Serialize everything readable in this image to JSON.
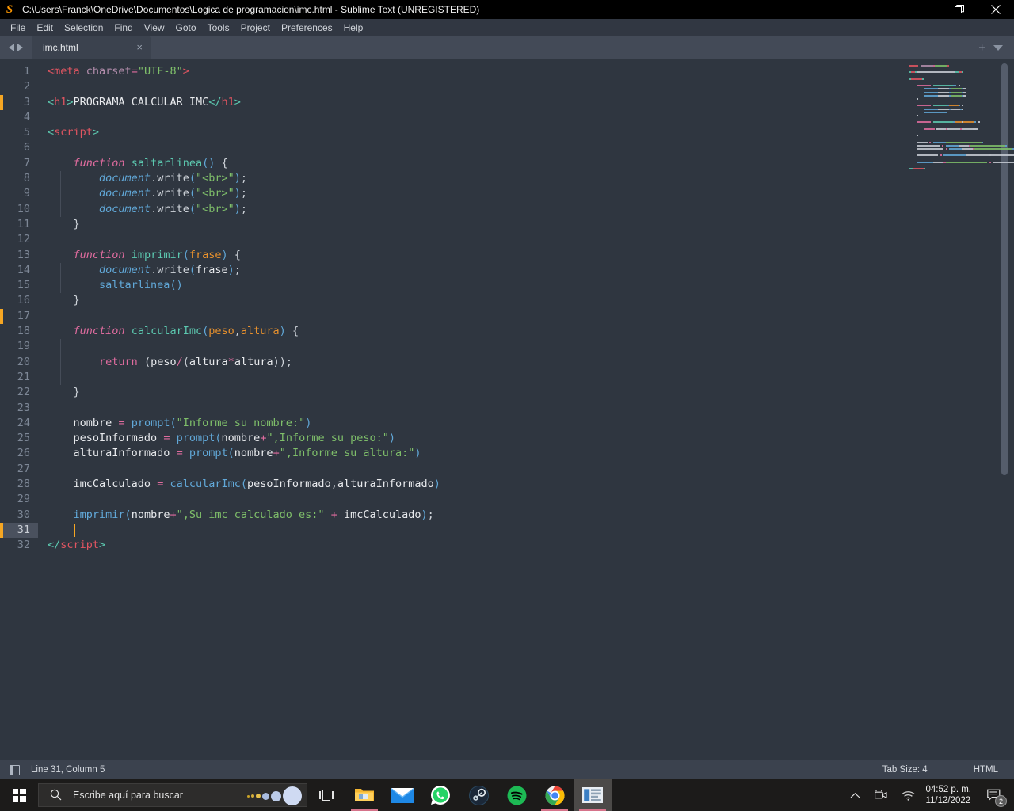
{
  "window": {
    "title": "C:\\Users\\Franck\\OneDrive\\Documentos\\Logica de programacion\\imc.html - Sublime Text (UNREGISTERED)",
    "app_icon": "sublime-text-icon",
    "minimize": "minimize-icon",
    "restore": "restore-icon",
    "close": "close-icon"
  },
  "menu": {
    "items": [
      {
        "label": "File"
      },
      {
        "label": "Edit"
      },
      {
        "label": "Selection"
      },
      {
        "label": "Find"
      },
      {
        "label": "View"
      },
      {
        "label": "Goto"
      },
      {
        "label": "Tools"
      },
      {
        "label": "Project"
      },
      {
        "label": "Preferences"
      },
      {
        "label": "Help"
      }
    ]
  },
  "tabbar": {
    "prev_icon": "chevron-left-icon",
    "next_icon": "chevron-right-icon",
    "tab_label": "imc.html",
    "tab_close": "×",
    "new_tab": "+",
    "dropdown": "chevron-down-icon"
  },
  "editor": {
    "first_line": 1,
    "total_lines": 32,
    "cursor_line": 31,
    "cursor_column": 5,
    "modified_lines": [
      3,
      17,
      31
    ],
    "lines": [
      {
        "n": 1,
        "tokens": [
          {
            "t": "tag",
            "v": "<meta"
          },
          {
            "t": "ws",
            "v": " "
          },
          {
            "t": "attr",
            "v": "charset"
          },
          {
            "t": "op",
            "v": "="
          },
          {
            "t": "str",
            "v": "\"UTF-8\""
          },
          {
            "t": "tag",
            "v": ">"
          }
        ]
      },
      {
        "n": 2,
        "tokens": []
      },
      {
        "n": 3,
        "tokens": [
          {
            "t": "tagp",
            "v": "<"
          },
          {
            "t": "tag",
            "v": "h1"
          },
          {
            "t": "tagp",
            "v": ">"
          },
          {
            "t": "var",
            "v": "PROGRAMA CALCULAR IMC"
          },
          {
            "t": "tagp",
            "v": "</"
          },
          {
            "t": "tag",
            "v": "h1"
          },
          {
            "t": "tagp",
            "v": ">"
          }
        ]
      },
      {
        "n": 4,
        "tokens": []
      },
      {
        "n": 5,
        "tokens": [
          {
            "t": "tagp",
            "v": "<"
          },
          {
            "t": "tag",
            "v": "script"
          },
          {
            "t": "tagp",
            "v": ">"
          }
        ]
      },
      {
        "n": 6,
        "tokens": []
      },
      {
        "n": 7,
        "tokens": [
          {
            "t": "ws",
            "v": "    "
          },
          {
            "t": "kw",
            "v": "function"
          },
          {
            "t": "ws",
            "v": " "
          },
          {
            "t": "fn",
            "v": "saltarlinea"
          },
          {
            "t": "call",
            "v": "()"
          },
          {
            "t": "ws",
            "v": " "
          },
          {
            "t": "punc",
            "v": "{"
          }
        ]
      },
      {
        "n": 8,
        "tokens": [
          {
            "t": "ws",
            "v": "        "
          },
          {
            "t": "obj",
            "v": "document"
          },
          {
            "t": "prop",
            "v": ".write"
          },
          {
            "t": "call",
            "v": "("
          },
          {
            "t": "str",
            "v": "\"<br>\""
          },
          {
            "t": "call",
            "v": ")"
          },
          {
            "t": "punc",
            "v": ";"
          }
        ]
      },
      {
        "n": 9,
        "tokens": [
          {
            "t": "ws",
            "v": "        "
          },
          {
            "t": "obj",
            "v": "document"
          },
          {
            "t": "prop",
            "v": ".write"
          },
          {
            "t": "call",
            "v": "("
          },
          {
            "t": "str",
            "v": "\"<br>\""
          },
          {
            "t": "call",
            "v": ")"
          },
          {
            "t": "punc",
            "v": ";"
          }
        ]
      },
      {
        "n": 10,
        "tokens": [
          {
            "t": "ws",
            "v": "        "
          },
          {
            "t": "obj",
            "v": "document"
          },
          {
            "t": "prop",
            "v": ".write"
          },
          {
            "t": "call",
            "v": "("
          },
          {
            "t": "str",
            "v": "\"<br>\""
          },
          {
            "t": "call",
            "v": ")"
          },
          {
            "t": "punc",
            "v": ";"
          }
        ]
      },
      {
        "n": 11,
        "tokens": [
          {
            "t": "ws",
            "v": "    "
          },
          {
            "t": "punc",
            "v": "}"
          }
        ]
      },
      {
        "n": 12,
        "tokens": []
      },
      {
        "n": 13,
        "tokens": [
          {
            "t": "ws",
            "v": "    "
          },
          {
            "t": "kw",
            "v": "function"
          },
          {
            "t": "ws",
            "v": " "
          },
          {
            "t": "fn",
            "v": "imprimir"
          },
          {
            "t": "call",
            "v": "("
          },
          {
            "t": "param",
            "v": "frase"
          },
          {
            "t": "call",
            "v": ")"
          },
          {
            "t": "ws",
            "v": " "
          },
          {
            "t": "punc",
            "v": "{"
          }
        ]
      },
      {
        "n": 14,
        "tokens": [
          {
            "t": "ws",
            "v": "        "
          },
          {
            "t": "obj",
            "v": "document"
          },
          {
            "t": "prop",
            "v": ".write"
          },
          {
            "t": "call",
            "v": "("
          },
          {
            "t": "var",
            "v": "frase"
          },
          {
            "t": "call",
            "v": ")"
          },
          {
            "t": "punc",
            "v": ";"
          }
        ]
      },
      {
        "n": 15,
        "tokens": [
          {
            "t": "ws",
            "v": "        "
          },
          {
            "t": "call",
            "v": "saltarlinea"
          },
          {
            "t": "call",
            "v": "()"
          }
        ]
      },
      {
        "n": 16,
        "tokens": [
          {
            "t": "ws",
            "v": "    "
          },
          {
            "t": "punc",
            "v": "}"
          }
        ]
      },
      {
        "n": 17,
        "tokens": []
      },
      {
        "n": 18,
        "tokens": [
          {
            "t": "ws",
            "v": "    "
          },
          {
            "t": "kw",
            "v": "function"
          },
          {
            "t": "ws",
            "v": " "
          },
          {
            "t": "fn",
            "v": "calcularImc"
          },
          {
            "t": "call",
            "v": "("
          },
          {
            "t": "param",
            "v": "peso"
          },
          {
            "t": "punc",
            "v": ","
          },
          {
            "t": "param",
            "v": "altura"
          },
          {
            "t": "call",
            "v": ")"
          },
          {
            "t": "ws",
            "v": " "
          },
          {
            "t": "punc",
            "v": "{"
          }
        ]
      },
      {
        "n": 19,
        "tokens": []
      },
      {
        "n": 20,
        "tokens": [
          {
            "t": "ws",
            "v": "        "
          },
          {
            "t": "kw2",
            "v": "return"
          },
          {
            "t": "ws",
            "v": " "
          },
          {
            "t": "punc",
            "v": "("
          },
          {
            "t": "var",
            "v": "peso"
          },
          {
            "t": "op",
            "v": "/"
          },
          {
            "t": "punc",
            "v": "("
          },
          {
            "t": "var",
            "v": "altura"
          },
          {
            "t": "op",
            "v": "*"
          },
          {
            "t": "var",
            "v": "altura"
          },
          {
            "t": "punc",
            "v": "))"
          },
          {
            "t": "punc",
            "v": ";"
          }
        ]
      },
      {
        "n": 21,
        "tokens": []
      },
      {
        "n": 22,
        "tokens": [
          {
            "t": "ws",
            "v": "    "
          },
          {
            "t": "punc",
            "v": "}"
          }
        ]
      },
      {
        "n": 23,
        "tokens": []
      },
      {
        "n": 24,
        "tokens": [
          {
            "t": "ws",
            "v": "    "
          },
          {
            "t": "var",
            "v": "nombre"
          },
          {
            "t": "ws",
            "v": " "
          },
          {
            "t": "op",
            "v": "="
          },
          {
            "t": "ws",
            "v": " "
          },
          {
            "t": "call",
            "v": "prompt"
          },
          {
            "t": "call",
            "v": "("
          },
          {
            "t": "str",
            "v": "\"Informe su nombre:\""
          },
          {
            "t": "call",
            "v": ")"
          }
        ]
      },
      {
        "n": 25,
        "tokens": [
          {
            "t": "ws",
            "v": "    "
          },
          {
            "t": "var",
            "v": "pesoInformado"
          },
          {
            "t": "ws",
            "v": " "
          },
          {
            "t": "op",
            "v": "="
          },
          {
            "t": "ws",
            "v": " "
          },
          {
            "t": "call",
            "v": "prompt"
          },
          {
            "t": "call",
            "v": "("
          },
          {
            "t": "var",
            "v": "nombre"
          },
          {
            "t": "op",
            "v": "+"
          },
          {
            "t": "str",
            "v": "\",Informe su peso:\""
          },
          {
            "t": "call",
            "v": ")"
          }
        ]
      },
      {
        "n": 26,
        "tokens": [
          {
            "t": "ws",
            "v": "    "
          },
          {
            "t": "var",
            "v": "alturaInformado"
          },
          {
            "t": "ws",
            "v": " "
          },
          {
            "t": "op",
            "v": "="
          },
          {
            "t": "ws",
            "v": " "
          },
          {
            "t": "call",
            "v": "prompt"
          },
          {
            "t": "call",
            "v": "("
          },
          {
            "t": "var",
            "v": "nombre"
          },
          {
            "t": "op",
            "v": "+"
          },
          {
            "t": "str",
            "v": "\",Informe su altura:\""
          },
          {
            "t": "call",
            "v": ")"
          }
        ]
      },
      {
        "n": 27,
        "tokens": []
      },
      {
        "n": 28,
        "tokens": [
          {
            "t": "ws",
            "v": "    "
          },
          {
            "t": "var",
            "v": "imcCalculado"
          },
          {
            "t": "ws",
            "v": " "
          },
          {
            "t": "op",
            "v": "="
          },
          {
            "t": "ws",
            "v": " "
          },
          {
            "t": "call",
            "v": "calcularImc"
          },
          {
            "t": "call",
            "v": "("
          },
          {
            "t": "var",
            "v": "pesoInformado"
          },
          {
            "t": "punc",
            "v": ","
          },
          {
            "t": "var",
            "v": "alturaInformado"
          },
          {
            "t": "call",
            "v": ")"
          }
        ]
      },
      {
        "n": 29,
        "tokens": []
      },
      {
        "n": 30,
        "tokens": [
          {
            "t": "ws",
            "v": "    "
          },
          {
            "t": "call",
            "v": "imprimir"
          },
          {
            "t": "call",
            "v": "("
          },
          {
            "t": "var",
            "v": "nombre"
          },
          {
            "t": "op",
            "v": "+"
          },
          {
            "t": "str",
            "v": "\",Su imc calculado es:\""
          },
          {
            "t": "ws",
            "v": " "
          },
          {
            "t": "op",
            "v": "+"
          },
          {
            "t": "ws",
            "v": " "
          },
          {
            "t": "var",
            "v": "imcCalculado"
          },
          {
            "t": "call",
            "v": ")"
          },
          {
            "t": "punc",
            "v": ";"
          }
        ]
      },
      {
        "n": 31,
        "tokens": [
          {
            "t": "ws",
            "v": "    "
          }
        ]
      },
      {
        "n": 32,
        "tokens": [
          {
            "t": "tagp",
            "v": "</"
          },
          {
            "t": "tag",
            "v": "script"
          },
          {
            "t": "tagp",
            "v": ">"
          }
        ]
      }
    ]
  },
  "minimap": {
    "label": "code-minimap",
    "scrollbar": "minimap-scrollbar"
  },
  "statusbar": {
    "sidebar_toggle": "sidebar-toggle-icon",
    "position": "Line 31, Column 5",
    "tab_size": "Tab Size: 4",
    "syntax": "HTML"
  },
  "taskbar": {
    "start": "windows-start-icon",
    "search_placeholder": "Escribe aquí para buscar",
    "search_icon": "search-icon",
    "cortana_icon": "cortana-icon",
    "task_view": "task-view-icon",
    "apps": [
      {
        "name": "file-explorer",
        "running": true
      },
      {
        "name": "mail",
        "running": false
      },
      {
        "name": "whatsapp",
        "running": false
      },
      {
        "name": "steam",
        "running": false
      },
      {
        "name": "spotify",
        "running": false
      },
      {
        "name": "google-chrome",
        "running": true
      },
      {
        "name": "sublime-text",
        "running": true,
        "active": true
      }
    ],
    "tray": {
      "show_hidden": "chevron-up-icon",
      "camera": "camera-icon",
      "network": "wifi-icon",
      "time": "04:52 p. m.",
      "date": "11/12/2022",
      "notifications_icon": "notification-icon",
      "notifications_count": "2"
    }
  },
  "colors": {
    "editor_bg": "#2f3640",
    "gutter_fg": "#7d8796",
    "accent_orange": "#f5a623",
    "tag": "#e05561",
    "string": "#7fbf6a",
    "keyword": "#e06c9f",
    "function": "#5cc9b0",
    "call": "#61a8d8",
    "param": "#e8912d"
  }
}
